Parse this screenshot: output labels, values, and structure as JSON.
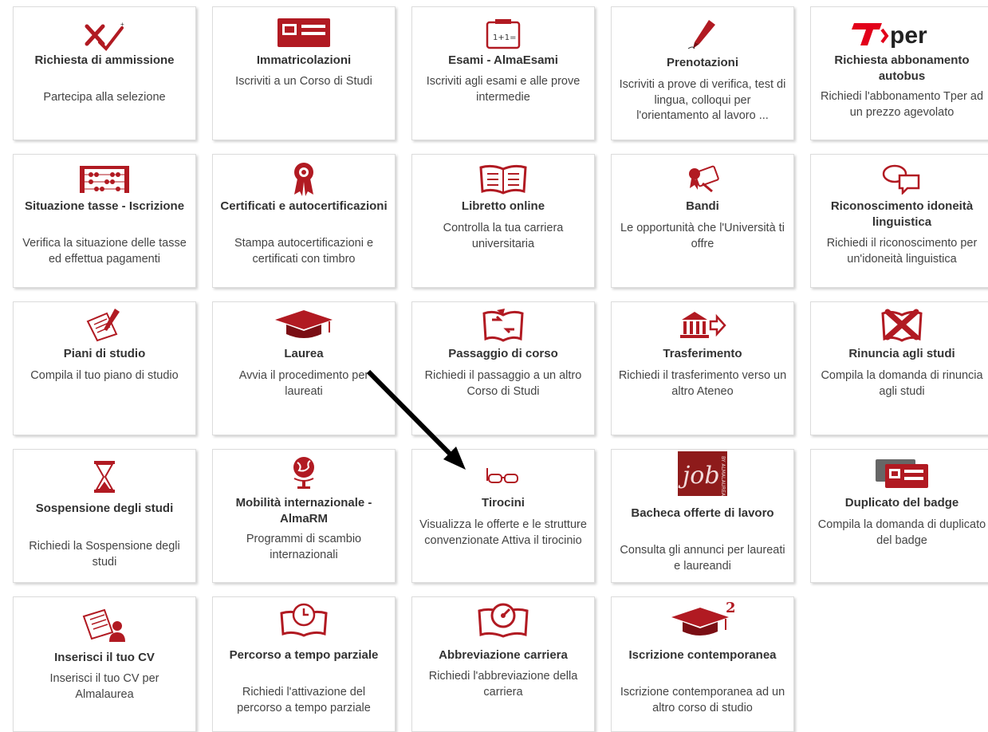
{
  "colors": {
    "accent": "#b11a22",
    "dark_red": "#7a0e14",
    "text": "#333333",
    "border": "#dcdcdc"
  },
  "tiles": [
    {
      "icon": "ballot-check-icon",
      "title": "Richiesta di ammissione",
      "desc": "Partecipa alla selezione"
    },
    {
      "icon": "id-card-icon",
      "title": "Immatricolazioni",
      "desc": "Iscriviti a un Corso di Studi"
    },
    {
      "icon": "exam-calendar-icon",
      "title": "Esami - AlmaEsami",
      "desc": "Iscriviti agli esami e alle prove intermedie"
    },
    {
      "icon": "pen-icon",
      "title": "Prenotazioni",
      "desc": "Iscriviti a prove di verifica, test di lingua, colloqui per l'orientamento al lavoro ..."
    },
    {
      "icon": "tper-logo-icon",
      "title": "Richiesta abbonamento autobus",
      "desc": "Richiedi l'abbonamento Tper ad un prezzo agevolato",
      "logo": "T per"
    },
    {
      "icon": "abacus-icon",
      "title": "Situazione tasse - Iscrizione",
      "desc": "Verifica la situazione delle tasse ed effettua pagamenti"
    },
    {
      "icon": "ribbon-award-icon",
      "title": "Certificati e autocertificazioni",
      "desc": "Stampa autocertificazioni e certificati con timbro"
    },
    {
      "icon": "open-book-icon",
      "title": "Libretto online",
      "desc": "Controlla la tua carriera universitaria"
    },
    {
      "icon": "bando-seal-icon",
      "title": "Bandi",
      "desc": "Le opportunità che l'Università ti offre"
    },
    {
      "icon": "speech-bubbles-icon",
      "title": "Riconoscimento idoneità linguistica",
      "desc": "Richiedi il riconoscimento per un'idoneità linguistica"
    },
    {
      "icon": "study-plan-pen-icon",
      "title": "Piani di studio",
      "desc": "Compila il tuo piano di studio"
    },
    {
      "icon": "graduation-cap-icon",
      "title": "Laurea",
      "desc": "Avvia il procedimento per laureati"
    },
    {
      "icon": "book-exchange-icon",
      "title": "Passaggio di corso",
      "desc": "Richiedi il passaggio a un altro Corso di Studi"
    },
    {
      "icon": "institution-arrow-icon",
      "title": "Trasferimento",
      "desc": "Richiedi il trasferimento verso un altro Ateneo"
    },
    {
      "icon": "book-cross-icon",
      "title": "Rinuncia agli studi",
      "desc": "Compila la domanda di rinuncia agli studi"
    },
    {
      "icon": "hourglass-icon",
      "title": "Sospensione degli studi",
      "desc": "Richiedi la Sospensione degli studi"
    },
    {
      "icon": "globe-icon",
      "title": "Mobilità internazionale - AlmaRM",
      "desc": "Programmi di scambio internazionali"
    },
    {
      "icon": "glasses-icon",
      "title": "Tirocini",
      "desc": "Visualizza le offerte e le strutture convenzionate Attiva il tirocinio"
    },
    {
      "icon": "job-logo-icon",
      "title": "Bacheca offerte di lavoro",
      "desc": "Consulta gli annunci per laureati e laureandi",
      "logo": "job"
    },
    {
      "icon": "badge-duplicate-icon",
      "title": "Duplicato del badge",
      "desc": "Compila la domanda di duplicato del badge"
    },
    {
      "icon": "cv-document-icon",
      "title": "Inserisci il tuo CV",
      "desc": "Inserisci il tuo CV per Almalaurea"
    },
    {
      "icon": "part-time-clock-icon",
      "title": "Percorso a tempo parziale",
      "desc": "Richiedi l'attivazione del percorso a tempo parziale"
    },
    {
      "icon": "speedometer-book-icon",
      "title": "Abbreviazione carriera",
      "desc": "Richiedi l'abbreviazione della carriera"
    },
    {
      "icon": "cap-two-icon",
      "title": "Iscrizione contemporanea",
      "desc": "Iscrizione contemporanea ad un altro corso di studio",
      "badge": "2"
    }
  ]
}
